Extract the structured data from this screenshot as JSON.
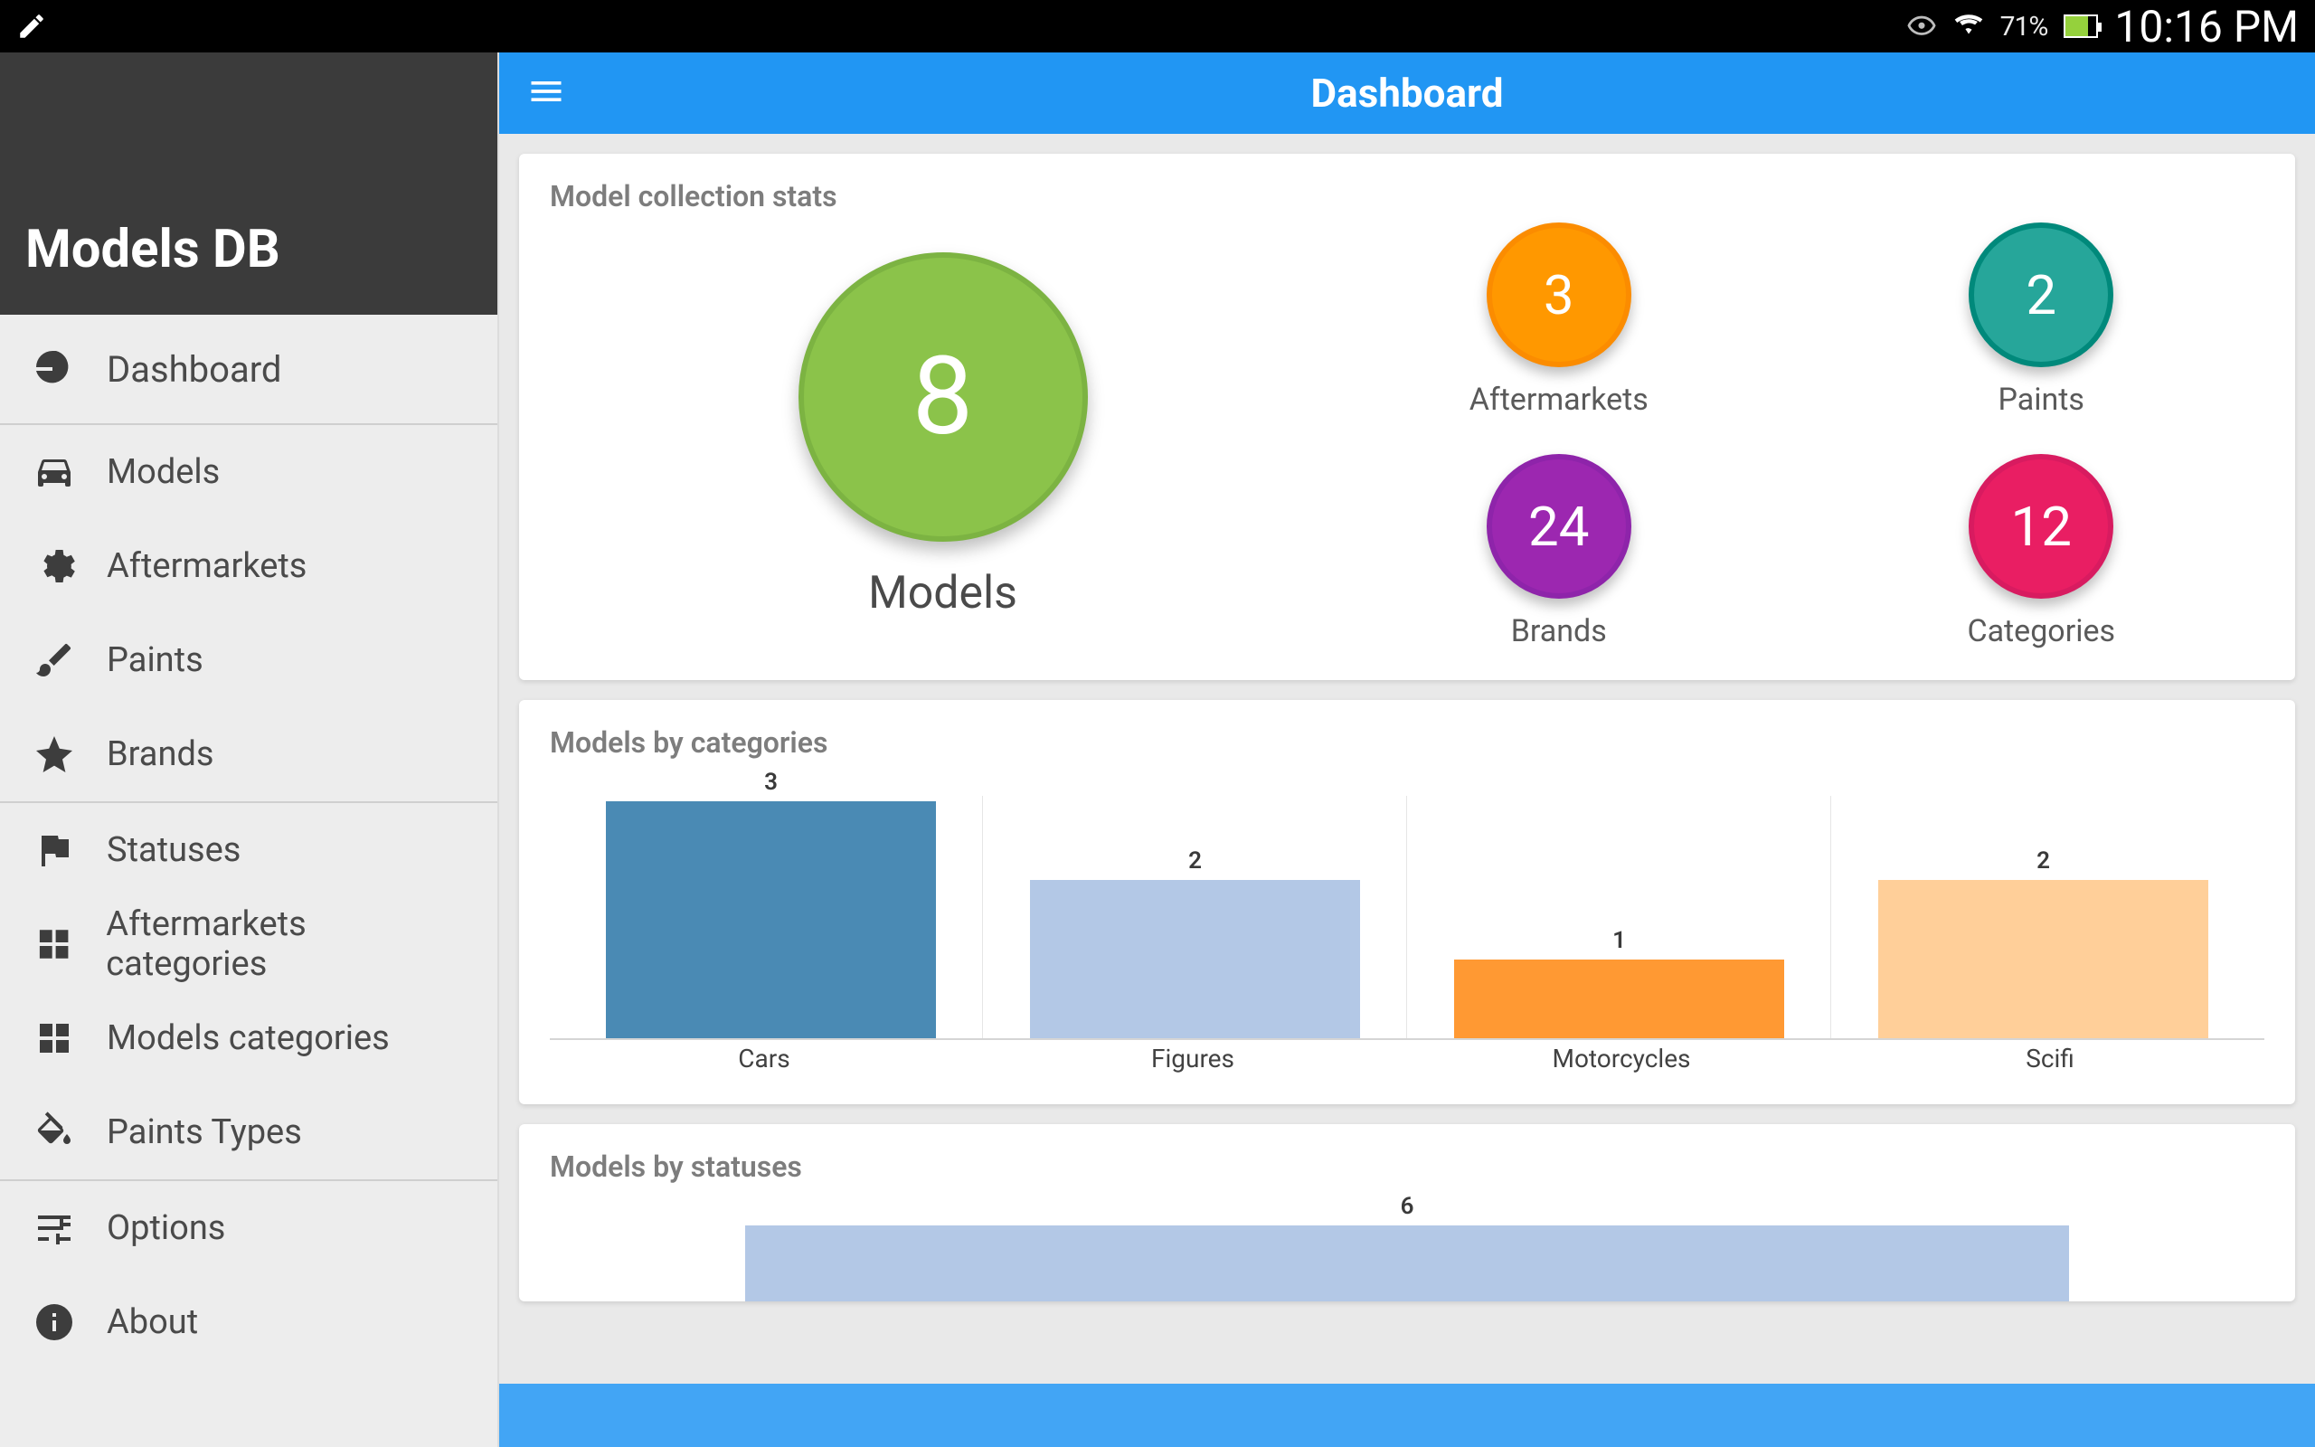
{
  "status_bar": {
    "battery_percent": "71%",
    "clock": "10:16 PM"
  },
  "sidebar": {
    "app_title": "Models DB",
    "items": [
      {
        "label": "Dashboard"
      },
      {
        "label": "Models"
      },
      {
        "label": "Aftermarkets"
      },
      {
        "label": "Paints"
      },
      {
        "label": "Brands"
      },
      {
        "label": "Statuses"
      },
      {
        "label": "Aftermarkets categories"
      },
      {
        "label": "Models categories"
      },
      {
        "label": "Paints Types"
      },
      {
        "label": "Options"
      },
      {
        "label": "About"
      }
    ],
    "groups": [
      [
        0
      ],
      [
        1,
        2,
        3,
        4
      ],
      [
        5,
        6,
        7,
        8
      ],
      [
        9,
        10
      ]
    ]
  },
  "app_bar": {
    "title": "Dashboard"
  },
  "stats_card": {
    "title": "Model collection stats",
    "main": {
      "value": "8",
      "label": "Models",
      "color": "#8bc34a",
      "border": "#7cb342"
    },
    "small": [
      {
        "value": "3",
        "label": "Aftermarkets",
        "color": "#ff9800",
        "border": "#fb8c00"
      },
      {
        "value": "2",
        "label": "Paints",
        "color": "#26a69a",
        "border": "#00897b"
      },
      {
        "value": "24",
        "label": "Brands",
        "color": "#9c27b0",
        "border": "#8e24aa"
      },
      {
        "value": "12",
        "label": "Categories",
        "color": "#e91e63",
        "border": "#d81b60"
      }
    ]
  },
  "chart_data": [
    {
      "type": "bar",
      "title": "Models by categories",
      "categories": [
        "Cars",
        "Figures",
        "Motorcycles",
        "Scifi"
      ],
      "values": [
        3,
        2,
        1,
        2
      ],
      "colors": [
        "#4a8ab4",
        "#b3c8e6",
        "#ff9933",
        "#ffcf99"
      ],
      "ymax": 3,
      "xlabel": "",
      "ylabel": ""
    },
    {
      "type": "bar",
      "title": "Models by statuses",
      "categories": [
        ""
      ],
      "values": [
        6
      ],
      "colors": [
        "#b3c8e6"
      ],
      "ymax": 6,
      "xlabel": "",
      "ylabel": ""
    }
  ]
}
